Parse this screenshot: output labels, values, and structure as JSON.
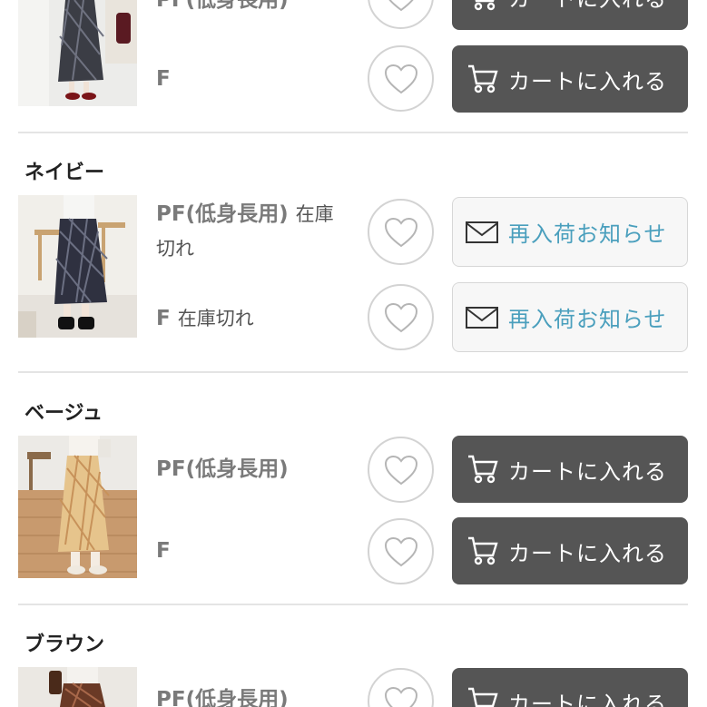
{
  "groups": [
    {
      "title": "",
      "rows": [
        {
          "size": "PF(低身長用)",
          "stock": "",
          "button": {
            "type": "cart",
            "label": "カートに入れる"
          }
        },
        {
          "size": "F",
          "stock": "",
          "button": {
            "type": "cart",
            "label": "カートに入れる"
          }
        }
      ]
    },
    {
      "title": "ネイビー",
      "rows": [
        {
          "size": "PF(低身長用)",
          "stock": "在庫切れ",
          "button": {
            "type": "notify",
            "label": "再入荷お知らせ"
          }
        },
        {
          "size": "F",
          "stock": "在庫切れ",
          "button": {
            "type": "notify",
            "label": "再入荷お知らせ"
          }
        }
      ]
    },
    {
      "title": "ベージュ",
      "rows": [
        {
          "size": "PF(低身長用)",
          "stock": "",
          "button": {
            "type": "cart",
            "label": "カートに入れる"
          }
        },
        {
          "size": "F",
          "stock": "",
          "button": {
            "type": "cart",
            "label": "カートに入れる"
          }
        }
      ]
    },
    {
      "title": "ブラウン",
      "rows": [
        {
          "size": "PF(低身長用)",
          "stock": "",
          "button": {
            "type": "cart",
            "label": "カートに入れる"
          }
        }
      ]
    }
  ],
  "icons": {
    "favorite": "heart-outline-icon",
    "cart": "cart-icon",
    "notify": "envelope-icon"
  },
  "colors": {
    "cart_button_bg": "#555555",
    "notify_text": "#4a9fbd",
    "heart_border": "#d3d3d3"
  }
}
